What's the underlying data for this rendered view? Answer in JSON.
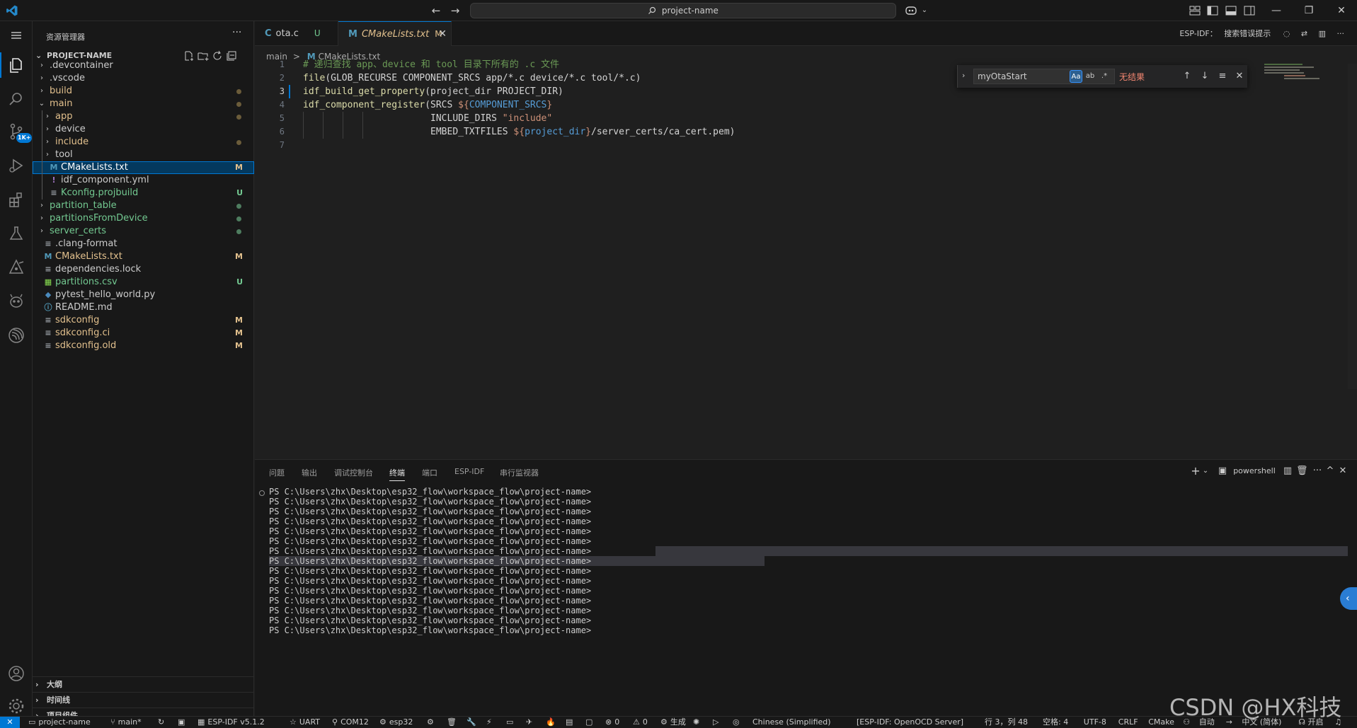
{
  "titlebar": {
    "search_text": "project-name",
    "nav_back": "←",
    "nav_forward": "→",
    "minimize": "—",
    "restore": "❐",
    "close": "✕"
  },
  "activity": {
    "scm_badge": "1K+"
  },
  "sidebar": {
    "title": "资源管理器",
    "more": "···",
    "project": "PROJECT-NAME",
    "tree": [
      {
        "label": ".devcontainer",
        "kind": "folder",
        "depth": 0,
        "color": "#cccccc",
        "status": ""
      },
      {
        "label": ".vscode",
        "kind": "folder",
        "depth": 0,
        "color": "#cccccc",
        "status": ""
      },
      {
        "label": "build",
        "kind": "folder",
        "depth": 0,
        "color": "#e2c08d",
        "status": "dot"
      },
      {
        "label": "main",
        "kind": "folder-open",
        "depth": 0,
        "color": "#e2c08d",
        "status": "dot"
      },
      {
        "label": "app",
        "kind": "folder",
        "depth": 1,
        "color": "#e2c08d",
        "status": "dot"
      },
      {
        "label": "device",
        "kind": "folder",
        "depth": 1,
        "color": "#cccccc",
        "status": ""
      },
      {
        "label": "include",
        "kind": "folder",
        "depth": 1,
        "color": "#e2c08d",
        "status": "dot"
      },
      {
        "label": "tool",
        "kind": "folder",
        "depth": 1,
        "color": "#cccccc",
        "status": ""
      },
      {
        "label": "CMakeLists.txt",
        "kind": "cmake",
        "depth": 1,
        "color": "#e2c08d",
        "status": "M",
        "selected": true
      },
      {
        "label": "idf_component.yml",
        "kind": "yml",
        "depth": 1,
        "color": "#cccccc",
        "status": ""
      },
      {
        "label": "Kconfig.projbuild",
        "kind": "lines",
        "depth": 1,
        "color": "#73c991",
        "status": "U"
      },
      {
        "label": "partition_table",
        "kind": "folder",
        "depth": 0,
        "color": "#73c991",
        "status": "dot"
      },
      {
        "label": "partitionsFromDevice",
        "kind": "folder",
        "depth": 0,
        "color": "#73c991",
        "status": "dot"
      },
      {
        "label": "server_certs",
        "kind": "folder",
        "depth": 0,
        "color": "#73c991",
        "status": "dot"
      },
      {
        "label": ".clang-format",
        "kind": "lines",
        "depth": 0,
        "color": "#cccccc",
        "status": ""
      },
      {
        "label": "CMakeLists.txt",
        "kind": "cmake",
        "depth": 0,
        "color": "#e2c08d",
        "status": "M"
      },
      {
        "label": "dependencies.lock",
        "kind": "lines",
        "depth": 0,
        "color": "#cccccc",
        "status": ""
      },
      {
        "label": "partitions.csv",
        "kind": "csv",
        "depth": 0,
        "color": "#73c991",
        "status": "U"
      },
      {
        "label": "pytest_hello_world.py",
        "kind": "py",
        "depth": 0,
        "color": "#cccccc",
        "status": ""
      },
      {
        "label": "README.md",
        "kind": "info",
        "depth": 0,
        "color": "#cccccc",
        "status": ""
      },
      {
        "label": "sdkconfig",
        "kind": "lines",
        "depth": 0,
        "color": "#e2c08d",
        "status": "M"
      },
      {
        "label": "sdkconfig.ci",
        "kind": "lines",
        "depth": 0,
        "color": "#e2c08d",
        "status": "M"
      },
      {
        "label": "sdkconfig.old",
        "kind": "lines",
        "depth": 0,
        "color": "#e2c08d",
        "status": "M"
      }
    ],
    "sections": [
      "大纲",
      "时间线",
      "项目组件"
    ]
  },
  "tabs": [
    {
      "icon": "C",
      "label": "ota.c",
      "status": "U",
      "active": false
    },
    {
      "icon": "M",
      "label": "CMakeLists.txt",
      "status": "M",
      "active": true,
      "close": "✕"
    }
  ],
  "editor_actions": {
    "esp_label": "ESP-IDF：",
    "hint_label": "搜索错误提示"
  },
  "breadcrumb": {
    "folder": "main",
    "sep": ">",
    "icon": "M",
    "file": "CMakeLists.txt"
  },
  "editor": {
    "current_line": 3,
    "lines": [
      [
        {
          "t": "# 递归查找 app、device 和 tool 目录下所有的 .c 文件",
          "c": "com"
        }
      ],
      [
        {
          "t": "file",
          "c": "fn"
        },
        {
          "t": "(GLOB_RECURSE COMPONENT_SRCS app/*.c device/*.c tool/*.c)",
          "c": "pl"
        }
      ],
      [
        {
          "t": "idf_build_get_property",
          "c": "fn"
        },
        {
          "t": "(project_dir PROJECT_DIR)",
          "c": "pl"
        }
      ],
      [
        {
          "t": "idf_component_register",
          "c": "fn"
        },
        {
          "t": "(SRCS ",
          "c": "pl"
        },
        {
          "t": "${",
          "c": "str"
        },
        {
          "t": "COMPONENT_SRCS",
          "c": "var"
        },
        {
          "t": "}",
          "c": "str"
        }
      ],
      [
        {
          "t": "                       INCLUDE_DIRS ",
          "c": "pl"
        },
        {
          "t": "\"include\"",
          "c": "str"
        }
      ],
      [
        {
          "t": "                       EMBED_TXTFILES ",
          "c": "pl"
        },
        {
          "t": "${",
          "c": "str"
        },
        {
          "t": "project_dir",
          "c": "var"
        },
        {
          "t": "}",
          "c": "str"
        },
        {
          "t": "/server_certs/ca_cert.pem)",
          "c": "pl"
        }
      ],
      []
    ]
  },
  "find": {
    "chevron": "›",
    "query": "myOtaStart",
    "opt_case": "Aa",
    "opt_word": "ab",
    "opt_regex": ".*",
    "no_results": "无结果",
    "prev": "↑",
    "next": "↓",
    "in_selection": "≡",
    "close": "✕"
  },
  "panel": {
    "tabs": [
      "问题",
      "输出",
      "调试控制台",
      "终端",
      "端口",
      "ESP-IDF",
      "串行监视器"
    ],
    "active_tab": 3,
    "add": "+",
    "add_dropdown": "⌄",
    "shell": "powershell",
    "more": "···",
    "maximize": "^",
    "close": "✕",
    "prompt": "PS C:\\Users\\zhx\\Desktop\\esp32_flow\\workspace_flow\\project-name>",
    "prompt_count": 15
  },
  "statusbar": {
    "remote": "✕",
    "items_left": [
      {
        "icon": "▭",
        "text": "project-name"
      },
      {
        "icon": "⑂",
        "text": "main*"
      },
      {
        "icon": "↻",
        "text": ""
      },
      {
        "icon": "▣",
        "text": ""
      },
      {
        "icon": "▦",
        "text": "ESP-IDF v5.1.2"
      },
      {
        "icon": "☆",
        "text": "UART"
      },
      {
        "icon": "⚲",
        "text": "COM12"
      },
      {
        "icon": "⚙",
        "text": "esp32"
      },
      {
        "icon": "⚙",
        "text": ""
      },
      {
        "icon": "🗑",
        "text": ""
      },
      {
        "icon": "🔧",
        "text": ""
      },
      {
        "icon": "⚡",
        "text": ""
      },
      {
        "icon": "▭",
        "text": ""
      },
      {
        "icon": "✈",
        "text": ""
      },
      {
        "icon": "🔥",
        "text": ""
      },
      {
        "icon": "▤",
        "text": ""
      },
      {
        "icon": "▢",
        "text": ""
      },
      {
        "icon": "⊗",
        "text": "0"
      },
      {
        "icon": "⚠",
        "text": "0"
      },
      {
        "icon": "⚙",
        "text": "生成"
      },
      {
        "icon": "✺",
        "text": ""
      },
      {
        "icon": "▷",
        "text": ""
      },
      {
        "icon": "◎",
        "text": ""
      },
      {
        "icon": "",
        "text": "Chinese (Simplified)"
      }
    ],
    "items_right": [
      {
        "text": "[ESP-IDF: OpenOCD Server]"
      },
      {
        "text": "行 3，列 48"
      },
      {
        "text": "空格: 4"
      },
      {
        "text": "UTF-8"
      },
      {
        "text": "CRLF"
      },
      {
        "text": "CMake"
      },
      {
        "text": "⚇"
      },
      {
        "text": "自动"
      },
      {
        "text": "→"
      },
      {
        "text": "中文 (简体)"
      },
      {
        "text": "☊ 开启"
      },
      {
        "text": "♫"
      }
    ]
  },
  "watermark": "CSDN @HX科技",
  "colors": {
    "accent": "#0078d4",
    "modified": "#e2c08d",
    "untracked": "#73c991",
    "error": "#f48771"
  }
}
